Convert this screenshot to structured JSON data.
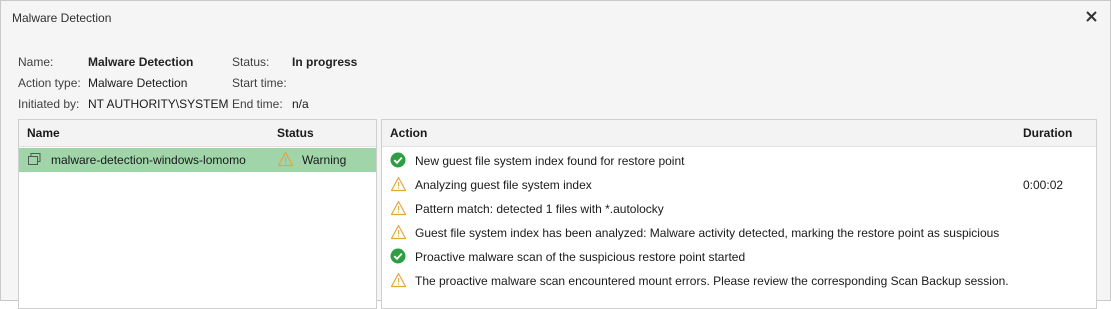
{
  "window": {
    "title": "Malware Detection"
  },
  "info": {
    "name_label": "Name:",
    "name_value": "Malware Detection",
    "action_type_label": "Action type:",
    "action_type_value": "Malware Detection",
    "initiated_by_label": "Initiated by:",
    "initiated_by_value": "NT AUTHORITY\\SYSTEM",
    "status_label": "Status:",
    "status_value": "In progress",
    "start_time_label": "Start time:",
    "start_time_value": "",
    "end_time_label": "End time:",
    "end_time_value": "n/a"
  },
  "left_table": {
    "headers": {
      "name": "Name",
      "status": "Status"
    },
    "rows": [
      {
        "name": "malware-detection-windows-lomomo",
        "status": "Warning",
        "icon": "vm-icon",
        "status_icon": "warning-icon"
      }
    ]
  },
  "right_table": {
    "headers": {
      "action": "Action",
      "duration": "Duration"
    },
    "rows": [
      {
        "icon": "success-icon",
        "text": "New guest file system index found for restore point",
        "duration": ""
      },
      {
        "icon": "warning-icon",
        "text": "Analyzing guest file system index",
        "duration": "0:00:02"
      },
      {
        "icon": "warning-icon",
        "text": "Pattern match: detected 1 files with *.autolocky",
        "duration": ""
      },
      {
        "icon": "warning-icon",
        "text": "Guest file system index has been analyzed: Malware activity detected, marking the restore point as suspicious",
        "duration": ""
      },
      {
        "icon": "success-icon",
        "text": "Proactive malware scan of the suspicious restore point started",
        "duration": ""
      },
      {
        "icon": "warning-icon",
        "text": "The proactive malware scan encountered mount errors. Please review the corresponding Scan Backup session.",
        "duration": ""
      }
    ]
  },
  "colors": {
    "success": "#2e9e44",
    "warning": "#e8a33d",
    "selection": "#9fd5a8"
  }
}
